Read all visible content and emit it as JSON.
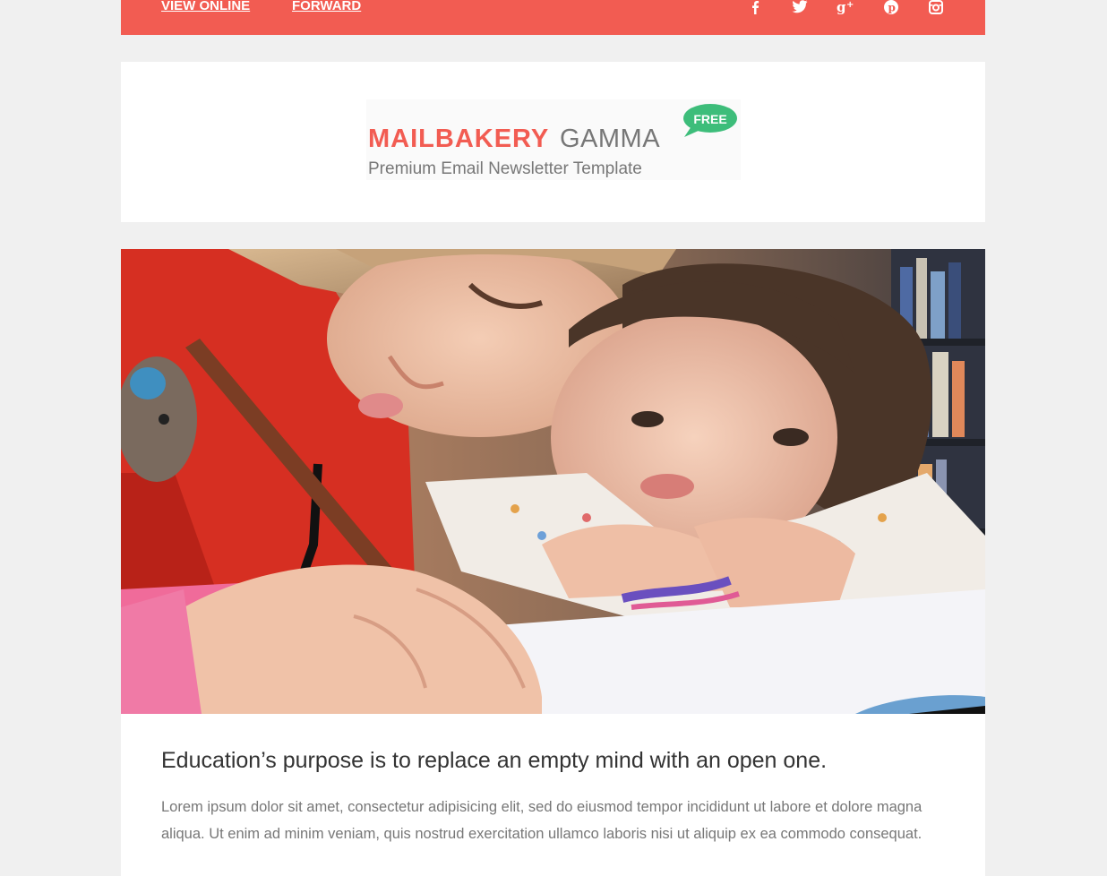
{
  "topbar": {
    "view_online": "VIEW ONLINE",
    "forward": "FORWARD",
    "social": [
      "facebook-icon",
      "twitter-icon",
      "google-plus-icon",
      "pinterest-icon",
      "instagram-icon"
    ],
    "bg_color": "#f25c52"
  },
  "logo": {
    "brand": "MAILBAKERY",
    "product": "GAMMA",
    "tagline": "Premium Email Newsletter Template",
    "badge": "FREE",
    "brand_color": "#f25c52",
    "badge_color": "#3dbd7a"
  },
  "hero": {
    "image": "photo-children-writing"
  },
  "content": {
    "headline": "Education’s purpose is to replace an empty mind with an open one.",
    "body": "Lorem ipsum dolor sit amet, consectetur adipisicing elit, sed do eiusmod tempor incididunt ut labore et dolore magna aliqua. Ut enim ad minim veniam, quis nostrud exercitation ullamco laboris nisi ut aliquip ex ea commodo consequat."
  }
}
